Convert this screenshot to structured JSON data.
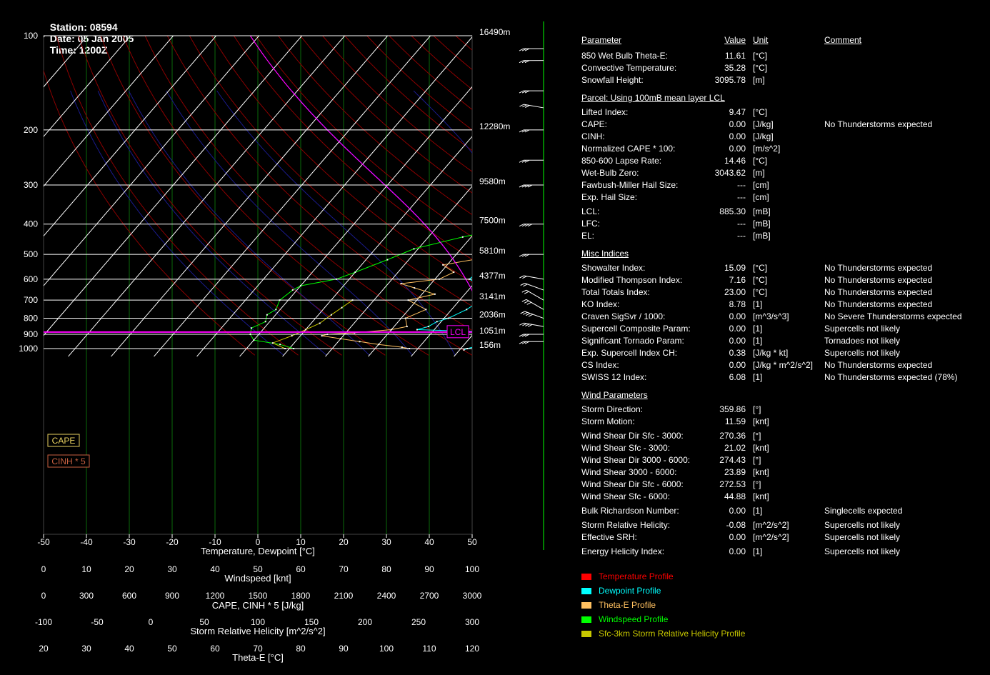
{
  "header": {
    "station": "Station: 08594",
    "date": "Date: 05 Jan 2005",
    "time": "Time: 1200Z"
  },
  "chart_data": {
    "type": "line",
    "title": "",
    "pressure_levels": [
      100,
      200,
      300,
      400,
      500,
      600,
      700,
      800,
      900,
      1000
    ],
    "height_labels": [
      {
        "p": 100,
        "label": "16490m"
      },
      {
        "p": 200,
        "label": "12280m"
      },
      {
        "p": 300,
        "label": "9580m"
      },
      {
        "p": 400,
        "label": "7500m"
      },
      {
        "p": 500,
        "label": "5810m"
      },
      {
        "p": 600,
        "label": "4377m"
      },
      {
        "p": 700,
        "label": "3141m"
      },
      {
        "p": 800,
        "label": "2036m"
      },
      {
        "p": 900,
        "label": "1051m"
      },
      {
        "p": 1000,
        "label": "156m"
      }
    ],
    "axes": [
      {
        "label": "Temperature, Dewpoint [°C]",
        "ticks": [
          "-50",
          "-40",
          "-30",
          "-20",
          "-10",
          "0",
          "10",
          "20",
          "30",
          "40",
          "50"
        ]
      },
      {
        "label": "Windspeed [knt]",
        "ticks": [
          "0",
          "10",
          "20",
          "30",
          "40",
          "50",
          "60",
          "70",
          "80",
          "90",
          "100"
        ]
      },
      {
        "label": "CAPE, CINH * 5 [J/kg]",
        "ticks": [
          "0",
          "300",
          "600",
          "900",
          "1200",
          "1500",
          "1800",
          "2100",
          "2400",
          "2700",
          "3000"
        ]
      },
      {
        "label": "Storm Relative Helicity [m^2/s^2]",
        "ticks": [
          "-100",
          "-50",
          "0",
          "50",
          "100",
          "150",
          "200",
          "250",
          "300"
        ]
      },
      {
        "label": "Theta-E [°C]",
        "ticks": [
          "20",
          "30",
          "40",
          "50",
          "60",
          "70",
          "80",
          "90",
          "100",
          "110",
          "120"
        ]
      }
    ],
    "boxes": {
      "cape": "CAPE",
      "cinh": "CINH * 5",
      "lcl": "LCL"
    },
    "lcl_pressure": 885.3,
    "series": [
      {
        "name": "Temperature Profile",
        "color": "#ff0000",
        "points": [
          [
            1010,
            21.5
          ],
          [
            1000,
            19
          ],
          [
            985,
            16
          ],
          [
            950,
            15
          ],
          [
            900,
            14
          ],
          [
            880,
            14
          ],
          [
            850,
            18.5
          ],
          [
            800,
            19
          ],
          [
            750,
            18.5
          ],
          [
            700,
            17.5
          ],
          [
            650,
            16
          ],
          [
            620,
            17
          ],
          [
            600,
            15
          ],
          [
            560,
            17.5
          ],
          [
            520,
            17
          ],
          [
            500,
            17
          ],
          [
            470,
            15
          ],
          [
            420,
            13
          ],
          [
            380,
            14
          ],
          [
            350,
            15
          ],
          [
            320,
            14
          ],
          [
            300,
            13
          ],
          [
            260,
            12.5
          ],
          [
            250,
            13
          ],
          [
            200,
            15
          ],
          [
            180,
            17
          ],
          [
            160,
            20
          ],
          [
            140,
            21.5
          ],
          [
            120,
            26
          ],
          [
            100,
            32
          ]
        ]
      },
      {
        "name": "Dewpoint Profile",
        "color": "#00ffff",
        "points": [
          [
            1010,
            11
          ],
          [
            1000,
            11.5
          ],
          [
            985,
            13
          ],
          [
            900,
            14
          ],
          [
            885,
            14
          ],
          [
            870,
            -4
          ],
          [
            850,
            -2
          ],
          [
            820,
            -1
          ],
          [
            800,
            1
          ],
          [
            750,
            3.5
          ],
          [
            700,
            5
          ],
          [
            650,
            3
          ],
          [
            620,
            1
          ],
          [
            600,
            -2
          ],
          [
            560,
            -1
          ],
          [
            520,
            -2
          ],
          [
            500,
            -2.5
          ],
          [
            470,
            -2
          ],
          [
            420,
            -1.5
          ],
          [
            380,
            0.5
          ],
          [
            350,
            1
          ],
          [
            320,
            1
          ],
          [
            300,
            1
          ],
          [
            270,
            1.5
          ],
          [
            250,
            1.5
          ]
        ]
      },
      {
        "name": "Theta-E Profile",
        "color": "#ffc060",
        "points": [
          [
            1000,
            -2
          ],
          [
            990,
            -4
          ],
          [
            970,
            -10
          ],
          [
            950,
            -15
          ],
          [
            930,
            -20
          ],
          [
            910,
            -25
          ],
          [
            900,
            -24
          ],
          [
            890,
            -18
          ],
          [
            870,
            -10
          ],
          [
            850,
            -7
          ],
          [
            800,
            -9
          ],
          [
            750,
            -6
          ],
          [
            700,
            -12
          ],
          [
            670,
            -7
          ],
          [
            640,
            -13
          ],
          [
            620,
            -17
          ],
          [
            600,
            -9
          ],
          [
            570,
            -7
          ],
          [
            540,
            -11
          ],
          [
            510,
            -2
          ],
          [
            500,
            -6
          ],
          [
            450,
            -7
          ],
          [
            410,
            -6
          ],
          [
            380,
            -7.5
          ],
          [
            350,
            -3
          ],
          [
            320,
            -3
          ],
          [
            300,
            -3
          ],
          [
            280,
            -2.5
          ],
          [
            250,
            -2
          ],
          [
            200,
            0
          ],
          [
            170,
            6
          ],
          [
            150,
            11
          ],
          [
            130,
            15
          ],
          [
            120,
            20
          ],
          [
            110,
            33
          ],
          [
            100,
            39
          ]
        ]
      },
      {
        "name": "Windspeed Profile",
        "color": "#00ff00",
        "points": [
          [
            1000,
            -29
          ],
          [
            970,
            -33
          ],
          [
            940,
            -40
          ],
          [
            900,
            -42
          ],
          [
            860,
            -43
          ],
          [
            820,
            -41
          ],
          [
            780,
            -42
          ],
          [
            750,
            -41
          ],
          [
            700,
            -42
          ],
          [
            650,
            -41
          ],
          [
            630,
            -40
          ],
          [
            600,
            -33
          ],
          [
            570,
            -30
          ],
          [
            520,
            -25
          ],
          [
            480,
            -21
          ],
          [
            440,
            -12
          ],
          [
            400,
            0
          ],
          [
            370,
            5
          ],
          [
            340,
            23
          ],
          [
            310,
            36
          ],
          [
            290,
            40
          ],
          [
            260,
            33
          ],
          [
            200,
            20
          ],
          [
            150,
            16
          ],
          [
            130,
            12
          ],
          [
            110,
            -6
          ],
          [
            100,
            -13
          ]
        ]
      },
      {
        "name": "Sfc-3km Storm Relative Helicity Profile",
        "color": "#c8c800",
        "points": [
          [
            1000,
            -31
          ],
          [
            960,
            -35
          ],
          [
            910,
            -32
          ],
          [
            870,
            -30
          ],
          [
            830,
            -28
          ],
          [
            780,
            -27
          ],
          [
            740,
            -26
          ],
          [
            700,
            -25
          ]
        ]
      }
    ],
    "wind_barbs": [
      {
        "p": 950,
        "dir": 270,
        "spd": 30
      },
      {
        "p": 900,
        "dir": 270,
        "spd": 30
      },
      {
        "p": 850,
        "dir": 280,
        "spd": 35
      },
      {
        "p": 800,
        "dir": 290,
        "spd": 35
      },
      {
        "p": 750,
        "dir": 300,
        "spd": 30
      },
      {
        "p": 700,
        "dir": 300,
        "spd": 20
      },
      {
        "p": 650,
        "dir": 290,
        "spd": 15
      },
      {
        "p": 600,
        "dir": 280,
        "spd": 20
      },
      {
        "p": 500,
        "dir": 270,
        "spd": 30
      },
      {
        "p": 400,
        "dir": 270,
        "spd": 35
      },
      {
        "p": 300,
        "dir": 270,
        "spd": 40
      },
      {
        "p": 250,
        "dir": 270,
        "spd": 30
      },
      {
        "p": 200,
        "dir": 270,
        "spd": 25
      },
      {
        "p": 170,
        "dir": 280,
        "spd": 25
      },
      {
        "p": 150,
        "dir": 270,
        "spd": 25
      },
      {
        "p": 120,
        "dir": 270,
        "spd": 30
      },
      {
        "p": 110,
        "dir": 270,
        "spd": 30
      }
    ]
  },
  "parameters": {
    "headers": {
      "param": "Parameter",
      "value": "Value",
      "unit": "Unit",
      "comment": "Comment"
    },
    "rows": [
      {
        "name": "850 Wet Bulb Theta-E:",
        "value": "11.61",
        "unit": "[°C]",
        "comment": ""
      },
      {
        "name": "Convective Temperature:",
        "value": "35.28",
        "unit": "[°C]",
        "comment": ""
      },
      {
        "name": "Snowfall Height:",
        "value": "3095.78",
        "unit": "[m]",
        "comment": ""
      },
      {
        "section": "Parcel: Using 100mB mean layer LCL"
      },
      {
        "name": "Lifted Index:",
        "value": "9.47",
        "unit": "[°C]",
        "comment": ""
      },
      {
        "name": "CAPE:",
        "value": "0.00",
        "unit": "[J/kg]",
        "comment": "No Thunderstorms expected"
      },
      {
        "name": "CINH:",
        "value": "0.00",
        "unit": "[J/kg]",
        "comment": ""
      },
      {
        "name": "Normalized CAPE * 100:",
        "value": "0.00",
        "unit": "[m/s^2]",
        "comment": ""
      },
      {
        "name": "850-600 Lapse Rate:",
        "value": "14.46",
        "unit": "[°C]",
        "comment": ""
      },
      {
        "name": "Wet-Bulb Zero:",
        "value": "3043.62",
        "unit": "[m]",
        "comment": ""
      },
      {
        "name": "Fawbush-Miller Hail Size:",
        "value": "---",
        "unit": "[cm]",
        "comment": ""
      },
      {
        "name": "Exp. Hail Size:",
        "value": "---",
        "unit": "[cm]",
        "comment": ""
      },
      {
        "name": "LCL:",
        "value": "885.30",
        "unit": "[mB]",
        "comment": ""
      },
      {
        "name": "LFC:",
        "value": "---",
        "unit": "[mB]",
        "comment": ""
      },
      {
        "name": "EL:",
        "value": "---",
        "unit": "[mB]",
        "comment": ""
      },
      {
        "section": "Misc Indices"
      },
      {
        "name": "Showalter Index:",
        "value": "15.09",
        "unit": "[°C]",
        "comment": "No Thunderstorms expected"
      },
      {
        "name": "Modified Thompson Index:",
        "value": "7.16",
        "unit": "[°C]",
        "comment": "No Thunderstorms expected"
      },
      {
        "name": "Total Totals Index:",
        "value": "23.00",
        "unit": "[°C]",
        "comment": "No Thunderstorms expected"
      },
      {
        "name": "KO Index:",
        "value": "8.78",
        "unit": "[1]",
        "comment": "No Thunderstorms expected"
      },
      {
        "name": "Craven SigSvr / 1000:",
        "value": "0.00",
        "unit": "[m^3/s^3]",
        "comment": "No Severe Thunderstorms expected"
      },
      {
        "name": "Supercell Composite Param:",
        "value": "0.00",
        "unit": "[1]",
        "comment": "Supercells not likely"
      },
      {
        "name": "Significant Tornado Param:",
        "value": "0.00",
        "unit": "[1]",
        "comment": "Tornadoes not likely"
      },
      {
        "name": "Exp. Supercell Index CH:",
        "value": "0.38",
        "unit": "[J/kg * kt]",
        "comment": "Supercells not likely"
      },
      {
        "name": "CS Index:",
        "value": "0.00",
        "unit": "[J/kg * m^2/s^2]",
        "comment": "No Thunderstorms expected"
      },
      {
        "name": "SWISS 12 Index:",
        "value": "6.08",
        "unit": "[1]",
        "comment": "No Thunderstorms expected (78%)"
      },
      {
        "section": "Wind Parameters"
      },
      {
        "name": "Storm Direction:",
        "value": "359.86",
        "unit": "[°]",
        "comment": ""
      },
      {
        "name": "Storm Motion:",
        "value": "11.59",
        "unit": "[knt]",
        "comment": ""
      },
      {
        "name": "Wind Shear Dir Sfc - 3000:",
        "value": "270.36",
        "unit": "[°]",
        "comment": ""
      },
      {
        "name": "Wind Shear Sfc - 3000:",
        "value": "21.02",
        "unit": "[knt]",
        "comment": ""
      },
      {
        "name": "Wind Shear Dir 3000 - 6000:",
        "value": "274.43",
        "unit": "[°]",
        "comment": ""
      },
      {
        "name": "Wind Shear 3000 - 6000:",
        "value": "23.89",
        "unit": "[knt]",
        "comment": ""
      },
      {
        "name": "Wind Shear Dir Sfc - 6000:",
        "value": "272.53",
        "unit": "[°]",
        "comment": ""
      },
      {
        "name": "Wind Shear Sfc - 6000:",
        "value": "44.88",
        "unit": "[knt]",
        "comment": ""
      },
      {
        "name": "Bulk Richardson Number:",
        "value": "0.00",
        "unit": "[1]",
        "comment": "Singlecells expected"
      },
      {
        "name": "Storm Relative Helicity:",
        "value": "-0.08",
        "unit": "[m^2/s^2]",
        "comment": "Supercells not likely"
      },
      {
        "name": "Effective SRH:",
        "value": "0.00",
        "unit": "[m^2/s^2]",
        "comment": "Supercells not likely"
      },
      {
        "name": "Energy Helicity Index:",
        "value": "0.00",
        "unit": "[1]",
        "comment": "Supercells not likely"
      }
    ]
  },
  "legend": [
    {
      "label": "Temperature Profile",
      "color": "#ff0000"
    },
    {
      "label": "Dewpoint Profile",
      "color": "#00ffff"
    },
    {
      "label": "Theta-E Profile",
      "color": "#ffc060"
    },
    {
      "label": "Windspeed Profile",
      "color": "#00ff00"
    },
    {
      "label": "Sfc-3km Storm Relative Helicity Profile",
      "color": "#c8c800"
    }
  ]
}
